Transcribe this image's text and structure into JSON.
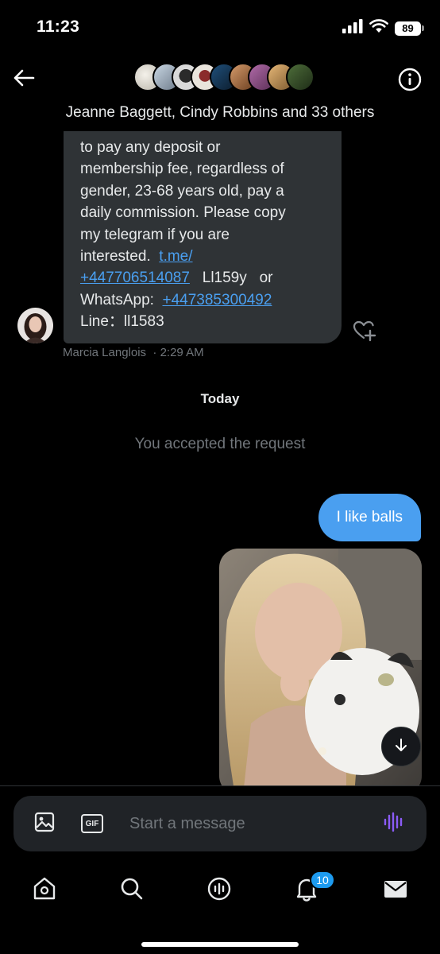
{
  "status_bar": {
    "time": "11:23",
    "battery": "89",
    "icons": [
      "cellular-signal-icon",
      "wifi-icon",
      "battery-icon"
    ]
  },
  "header": {
    "title": "Jeanne Baggett, Cindy Robbins and 33 others",
    "back_icon": "arrow-left-icon",
    "info_icon": "info-circle-icon",
    "participant_avatar_count": 9
  },
  "messages": {
    "incoming": {
      "lines": [
        "to pay any deposit or",
        "membership fee, regardless of",
        "gender, 23-68 years old, pay a",
        "daily commission. Please copy",
        "my telegram if you are"
      ],
      "interested": "interested.",
      "telegram_link_part1": "t.me/",
      "telegram_link_part2": "+447706514087",
      "telegram_suffix": "Ll159y",
      "or_text": "or",
      "whatsapp_label": "WhatsApp:",
      "whatsapp_link": "+447385300492",
      "line_text": "Line：ll1583",
      "sender_name": "Marcia Langlois",
      "time": "2:29 AM"
    },
    "date_separator": "Today",
    "system_message": "You accepted the request",
    "outgoing": {
      "text": "I like balls"
    }
  },
  "composer": {
    "placeholder": "Start a message",
    "gif_label": "GIF",
    "icons": [
      "image-icon",
      "gif-icon",
      "voice-waveform-icon"
    ]
  },
  "bottom_nav": {
    "items": [
      "home-icon",
      "search-icon",
      "spaces-icon",
      "notifications-bell-icon",
      "messages-envelope-icon"
    ],
    "notification_badge": "10"
  },
  "colors": {
    "background": "#000000",
    "incoming_bubble": "#2f3336",
    "outgoing_bubble": "#4a9ff0",
    "link": "#4a9ff0",
    "muted_text": "#71767b",
    "voice_icon": "#8b5cf6",
    "badge": "#1d9bf0"
  }
}
